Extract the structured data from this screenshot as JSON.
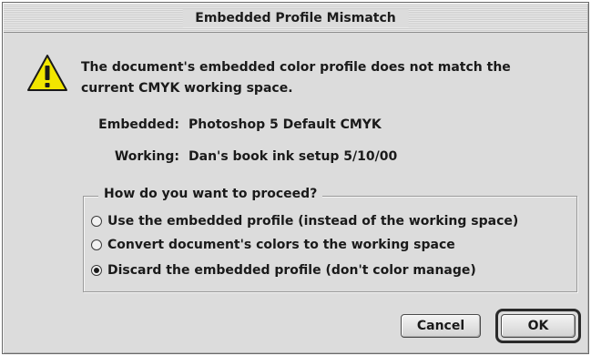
{
  "dialog": {
    "title": "Embedded Profile Mismatch",
    "icon": "warning-icon",
    "message": "The document's embedded color profile does not match the current CMYK working space.",
    "embedded_label": "Embedded:",
    "embedded_value": "Photoshop 5 Default CMYK",
    "working_label": "Working:",
    "working_value": "Dan's book ink setup 5/10/00",
    "group_title": "How do you want to proceed?",
    "options": [
      {
        "label": "Use the embedded profile (instead of the working space)",
        "selected": false
      },
      {
        "label": "Convert document's colors to the working space",
        "selected": false
      },
      {
        "label": "Discard the embedded profile (don't color manage)",
        "selected": true
      }
    ],
    "cancel_label": "Cancel",
    "ok_label": "OK"
  },
  "colors": {
    "dialog_bg": "#dcdcdc",
    "warning_fill": "#f2e600",
    "text": "#1a1a1a"
  }
}
